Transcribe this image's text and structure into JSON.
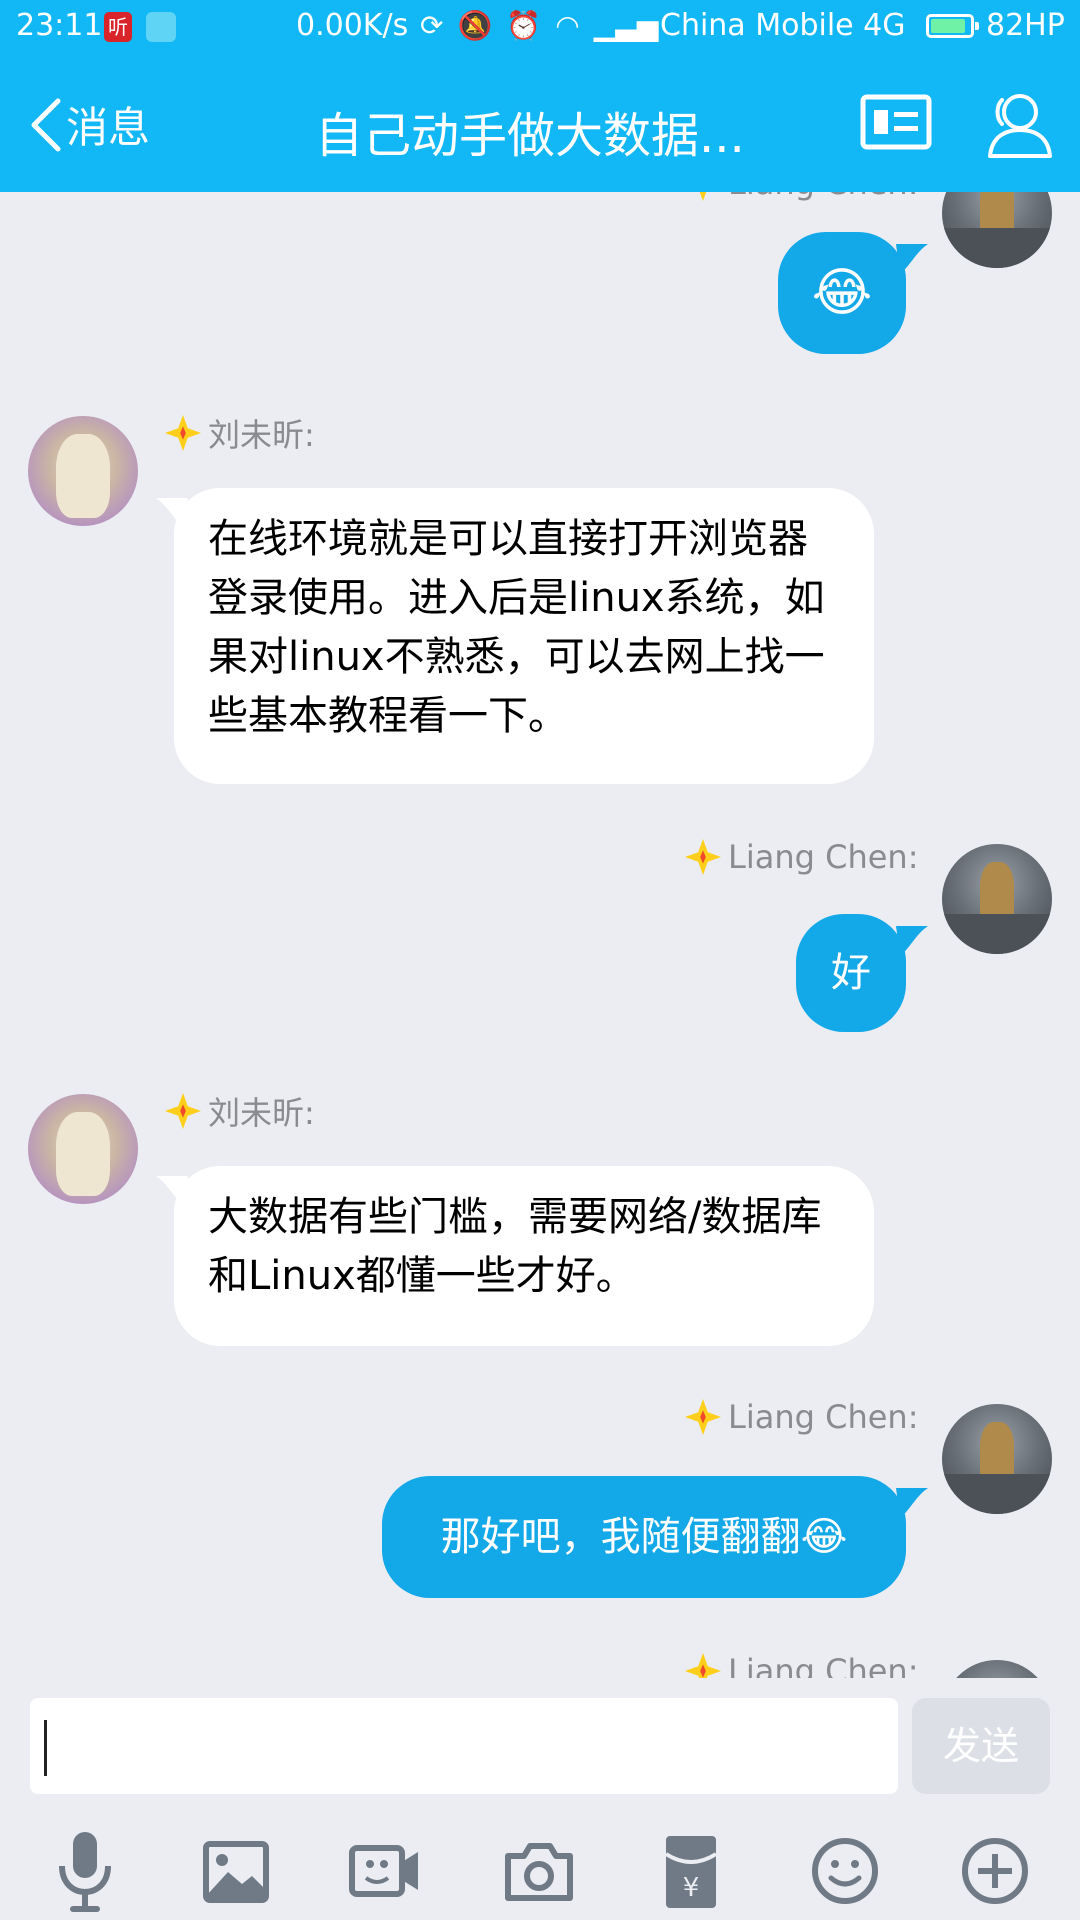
{
  "status_bar": {
    "time": "23:11",
    "app1_label": "听",
    "speed": "0.00K/s",
    "carrier": "China Mobile 4G",
    "battery": "82HP",
    "battery_level": 0.82
  },
  "nav": {
    "back_label": "消息",
    "title": "自己动手做大数据..."
  },
  "messages": [
    {
      "sender": "Liang Chen:",
      "side": "out",
      "text": "😂"
    },
    {
      "sender": "刘未昕:",
      "side": "in",
      "text": "在线环境就是可以直接打开浏览器登录使用。进入后是linux系统，如果对linux不熟悉，可以去网上找一些基本教程看一下。"
    },
    {
      "sender": "Liang Chen:",
      "side": "out",
      "text": "好"
    },
    {
      "sender": "刘未昕:",
      "side": "in",
      "text": "大数据有些门槛，需要网络/数据库和Linux都懂一些才好。"
    },
    {
      "sender": "Liang Chen:",
      "side": "out",
      "text": "那好吧，我随便翻翻😂"
    },
    {
      "sender": "Liang Chen:",
      "side": "out",
      "text": ""
    }
  ],
  "input": {
    "value": "",
    "send_label": "发送"
  },
  "toolbar_icons": [
    "microphone-icon",
    "image-icon",
    "video-call-icon",
    "camera-icon",
    "red-packet-icon",
    "emoji-icon",
    "plus-icon"
  ],
  "colors": {
    "header": "#12b7f5",
    "outgoing_bubble": "#13a8e8",
    "incoming_bubble": "#ffffff",
    "background": "#ebedf2"
  }
}
